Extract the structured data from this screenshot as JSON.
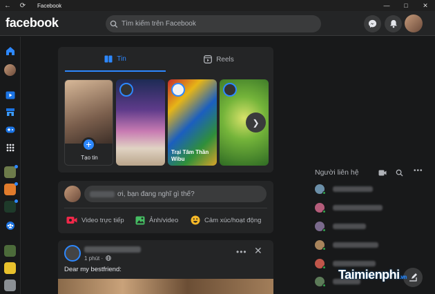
{
  "window": {
    "title": "Facebook"
  },
  "header": {
    "logo": "facebook",
    "search_placeholder": "Tìm kiếm trên Facebook"
  },
  "tabs": {
    "news": "Tin",
    "reels": "Reels"
  },
  "stories": {
    "create_label": "Tạo tin",
    "items": [
      {
        "name": ""
      },
      {
        "name": "Trại Tâm Thần Wibu"
      },
      {
        "name": ""
      }
    ]
  },
  "composer": {
    "prompt_suffix": "ơi, bạn đang nghĩ gì thế?",
    "actions": {
      "live": "Video trực tiếp",
      "photo": "Ảnh/video",
      "feeling": "Cảm xúc/hoạt động"
    }
  },
  "post": {
    "time": "1 phút ·",
    "text": "Dear my bestfriend:"
  },
  "contacts": {
    "title": "Người liên hệ",
    "count": 6
  },
  "watermark": {
    "brand": "Taimienphi",
    "suffix": ".vn"
  },
  "colors": {
    "accent": "#2d88ff",
    "bg": "#18191a",
    "card": "#242526",
    "online": "#31a24c"
  }
}
